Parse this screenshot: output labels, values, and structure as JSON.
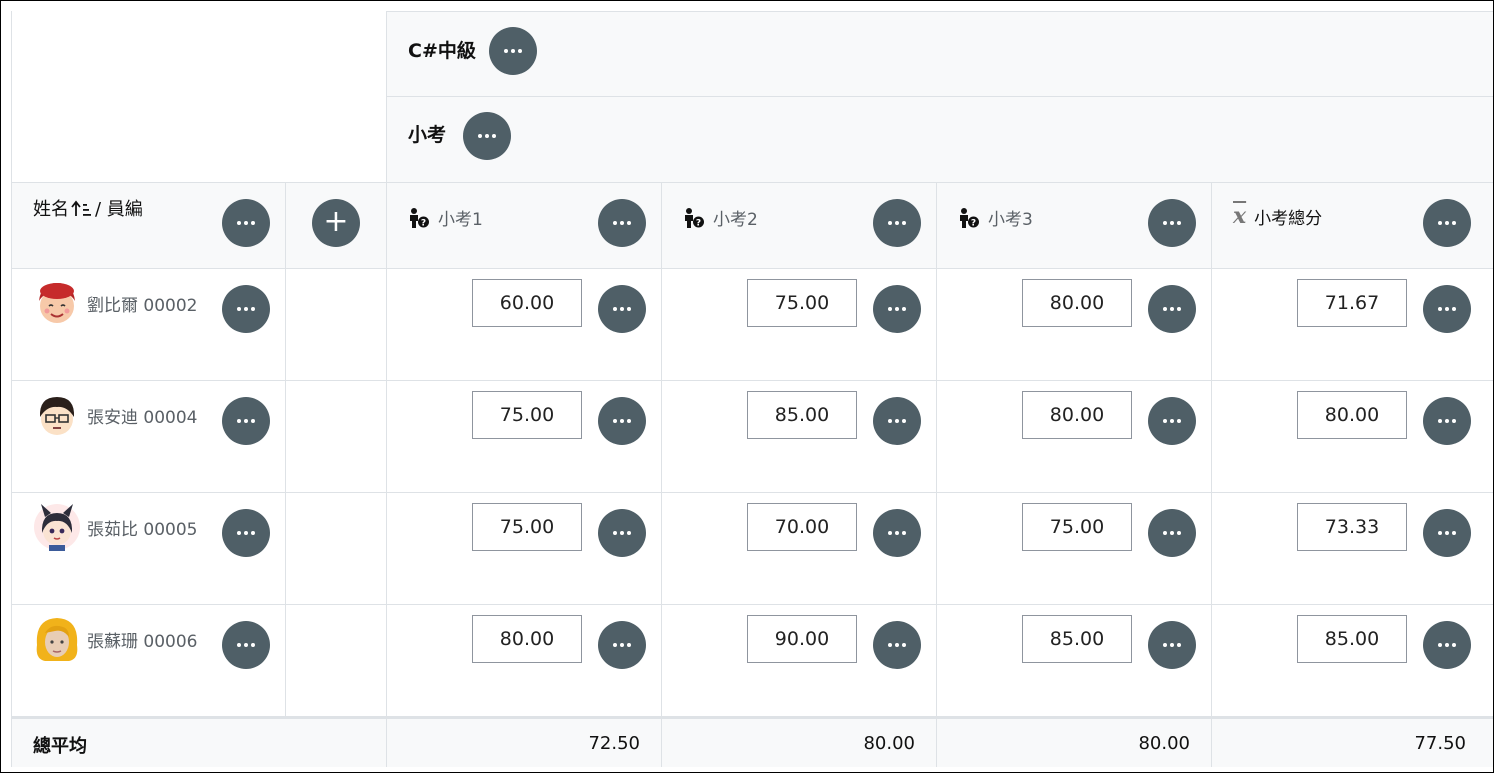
{
  "course": {
    "title": "C#中級"
  },
  "category": {
    "title": "小考"
  },
  "header": {
    "name_label": "姓名",
    "sort_icon": "sort-ascending-icon",
    "name_suffix": "/ 員編",
    "add_icon": "plus-icon"
  },
  "columns": [
    {
      "label": "小考1",
      "icon": "manual-grade-icon"
    },
    {
      "label": "小考2",
      "icon": "manual-grade-icon"
    },
    {
      "label": "小考3",
      "icon": "manual-grade-icon"
    },
    {
      "label": "小考總分",
      "icon": "mean-x-bar-icon"
    }
  ],
  "students": [
    {
      "name": "劉比爾 00002",
      "avatar": "avatar-red-hair",
      "scores": [
        "60.00",
        "75.00",
        "80.00",
        "71.67"
      ]
    },
    {
      "name": "張安迪 00004",
      "avatar": "avatar-glasses",
      "scores": [
        "75.00",
        "85.00",
        "80.00",
        "80.00"
      ]
    },
    {
      "name": "張茹比 00005",
      "avatar": "avatar-bunny-ears",
      "scores": [
        "75.00",
        "70.00",
        "75.00",
        "73.33"
      ]
    },
    {
      "name": "張蘇珊 00006",
      "avatar": "avatar-blonde",
      "scores": [
        "80.00",
        "90.00",
        "85.00",
        "85.00"
      ]
    }
  ],
  "footer": {
    "label": "總平均",
    "averages": [
      "72.50",
      "80.00",
      "80.00",
      "77.50"
    ]
  },
  "colors": {
    "button": "#4f5f67",
    "header_bg": "#f8f9fa",
    "border": "#dee2e6"
  }
}
